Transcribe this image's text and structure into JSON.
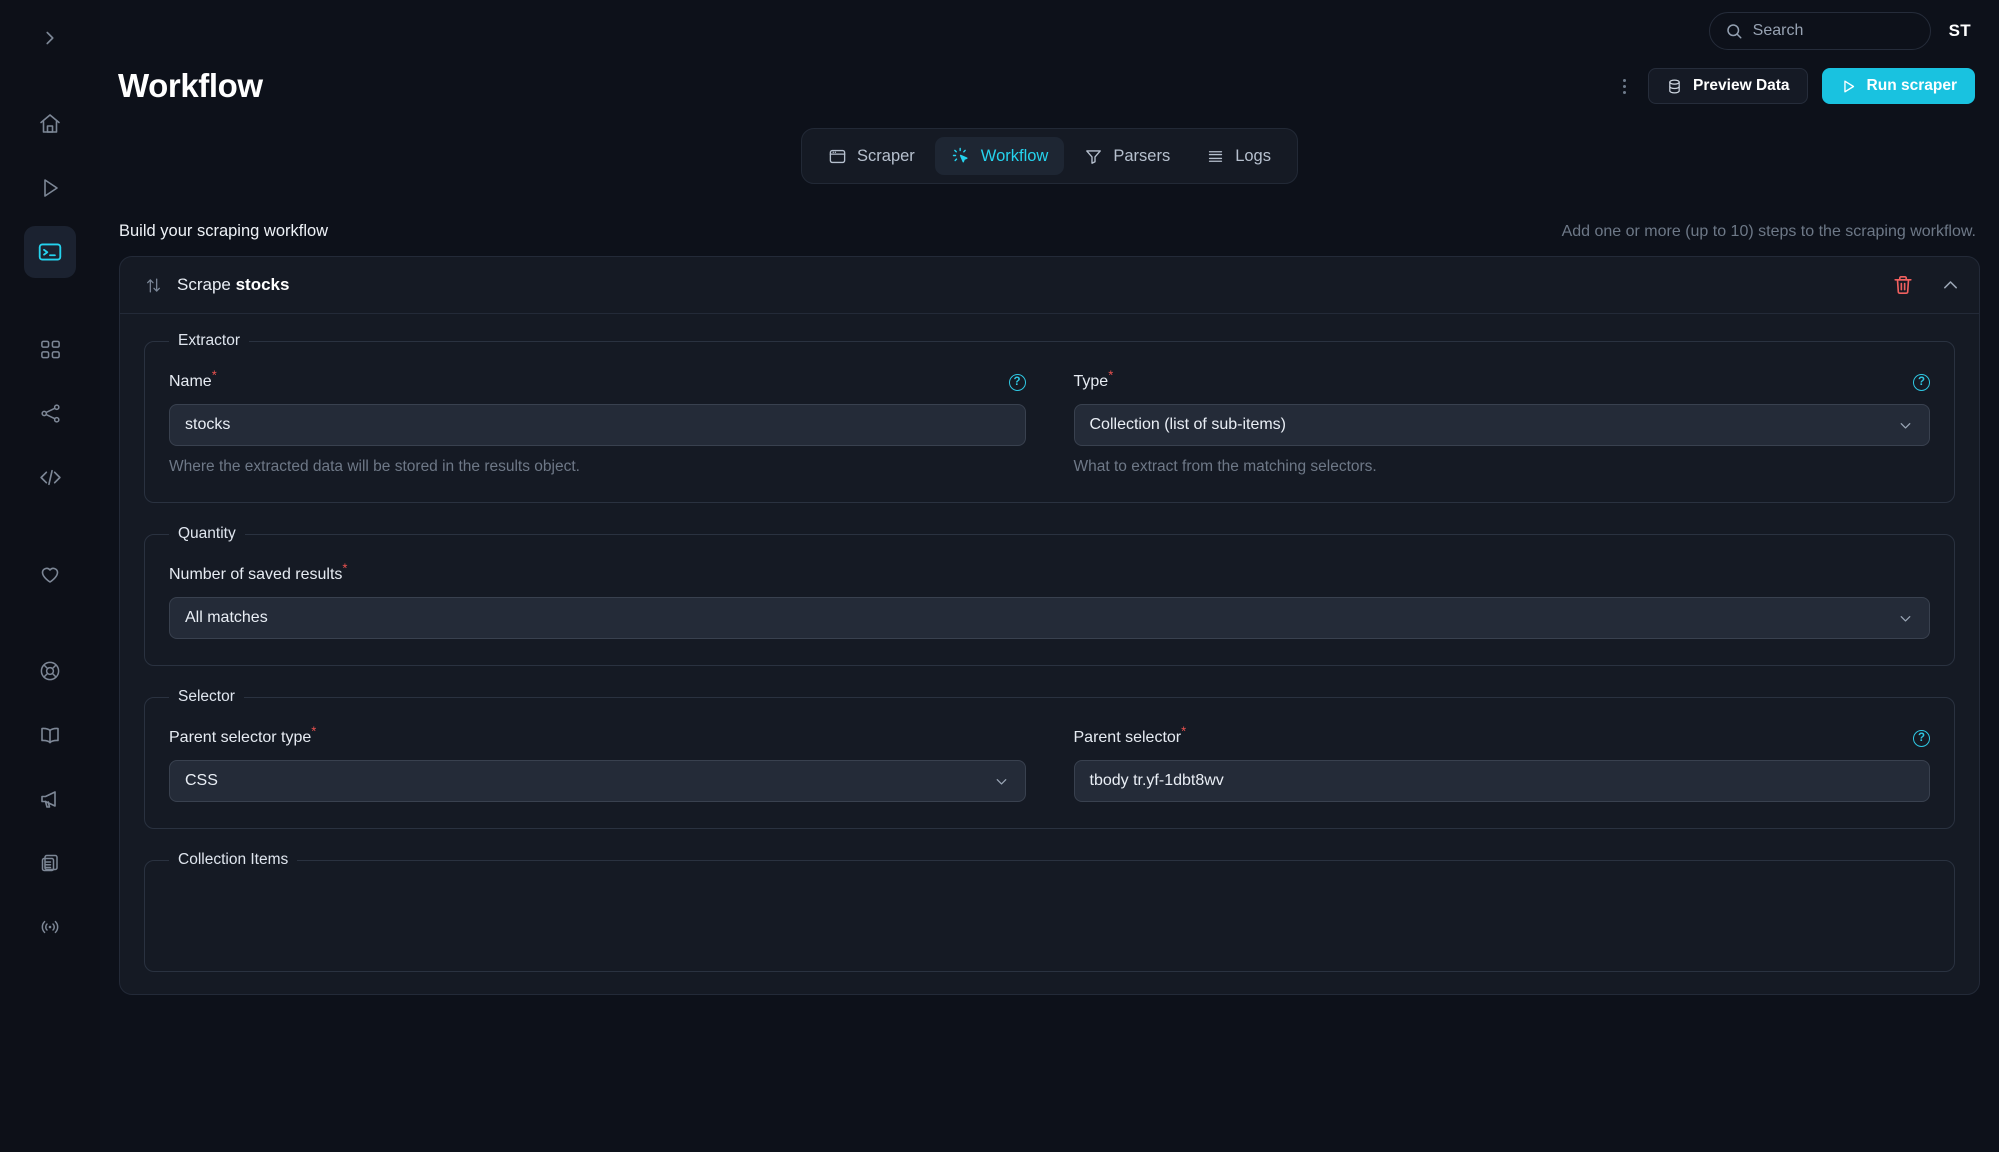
{
  "sidebar": {
    "collapse_toggle": "chevron-right-icon",
    "items": [
      {
        "name": "home",
        "icon": "home-icon",
        "active": false
      },
      {
        "name": "runs",
        "icon": "play-icon",
        "active": false
      },
      {
        "name": "scrapers",
        "icon": "terminal-icon",
        "active": true
      },
      {
        "name": "apps",
        "icon": "grid-icon",
        "active": false
      },
      {
        "name": "integrations",
        "icon": "share-icon",
        "active": false
      },
      {
        "name": "api",
        "icon": "code-icon",
        "active": false
      },
      {
        "name": "favorites",
        "icon": "heart-icon",
        "active": false
      },
      {
        "name": "support",
        "icon": "lifebuoy-icon",
        "active": false
      },
      {
        "name": "docs",
        "icon": "book-icon",
        "active": false
      },
      {
        "name": "announcements",
        "icon": "megaphone-icon",
        "active": false
      },
      {
        "name": "clipboard",
        "icon": "clipboard-list-icon",
        "active": false
      },
      {
        "name": "status",
        "icon": "broadcast-icon",
        "active": false
      }
    ]
  },
  "topbar": {
    "search_placeholder": "Search",
    "search_value": "",
    "avatar_initials": "ST"
  },
  "header": {
    "title": "Workflow",
    "more_label": "More options",
    "preview_label": "Preview Data",
    "run_label": "Run scraper"
  },
  "tabs": [
    {
      "id": "scraper",
      "label": "Scraper",
      "icon": "browser-icon",
      "active": false
    },
    {
      "id": "workflow",
      "label": "Workflow",
      "icon": "click-icon",
      "active": true
    },
    {
      "id": "parsers",
      "label": "Parsers",
      "icon": "funnel-icon",
      "active": false
    },
    {
      "id": "logs",
      "label": "Logs",
      "icon": "lines-icon",
      "active": false
    }
  ],
  "section": {
    "title": "Build your scraping workflow",
    "hint": "Add one or more (up to 10) steps to the scraping workflow."
  },
  "step": {
    "title_prefix": "Scrape ",
    "title_name": "stocks",
    "delete_label": "Delete step",
    "collapse_label": "Collapse step"
  },
  "extractor": {
    "legend": "Extractor",
    "name": {
      "label": "Name",
      "required_mark": "*",
      "value": "stocks",
      "helper": "Where the extracted data will be stored in the results object.",
      "help_glyph": "?"
    },
    "type": {
      "label": "Type",
      "required_mark": "*",
      "value": "Collection (list of sub-items)",
      "helper": "What to extract from the matching selectors.",
      "help_glyph": "?"
    }
  },
  "quantity": {
    "legend": "Quantity",
    "saved_results": {
      "label": "Number of saved results",
      "required_mark": "*",
      "value": "All matches"
    }
  },
  "selector": {
    "legend": "Selector",
    "parent_selector_type": {
      "label": "Parent selector type",
      "required_mark": "*",
      "value": "CSS"
    },
    "parent_selector": {
      "label": "Parent selector",
      "required_mark": "*",
      "value": "tbody tr.yf-1dbt8wv",
      "help_glyph": "?"
    }
  },
  "collection_items": {
    "legend": "Collection Items"
  },
  "colors": {
    "background": "#0d111a",
    "sidebar": "#0d1018",
    "panel": "#151a24",
    "accent": "#25d3ee",
    "primary_button": "#19c2e0",
    "danger": "#f0605f",
    "input": "#242b38",
    "muted_text": "#6e7887"
  }
}
